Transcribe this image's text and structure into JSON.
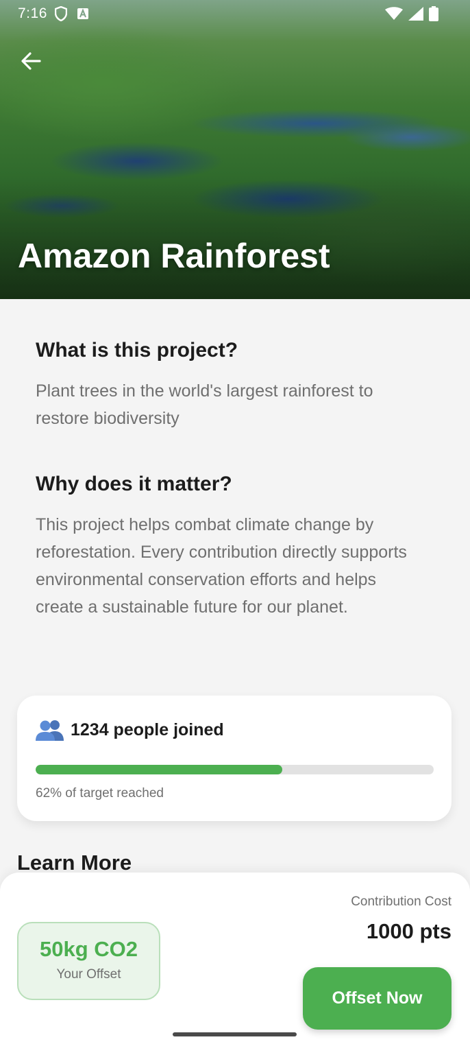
{
  "status_bar": {
    "time": "7:16",
    "left_icons": [
      "shield-icon",
      "font-icon"
    ],
    "right_icons": [
      "wifi-icon",
      "signal-icon",
      "battery-icon"
    ]
  },
  "hero": {
    "title": "Amazon Rainforest",
    "back_icon": "arrow-back-icon"
  },
  "about": {
    "title": "What is this project?",
    "text": "Plant trees in the world's largest rainforest to restore biodiversity"
  },
  "importance": {
    "title": "Why does it matter?",
    "text": "This project helps combat climate change by reforestation. Every contribution directly supports environmental conservation efforts and helps create a sustainable future for our planet."
  },
  "stats": {
    "icon": "people-icon",
    "people_joined": "1234 people joined",
    "progress_percent": 62,
    "progress_caption": "62% of target reached"
  },
  "learn_more": {
    "title": "Learn More"
  },
  "footer": {
    "offset_value": "50kg CO2",
    "offset_label": "Your Offset",
    "cost_label": "Contribution Cost",
    "cost_value": "1000 pts",
    "button_label": "Offset Now"
  },
  "colors": {
    "accent": "#4caf50",
    "badge_bg": "#eaf5ea",
    "background": "#f4f4f4"
  }
}
